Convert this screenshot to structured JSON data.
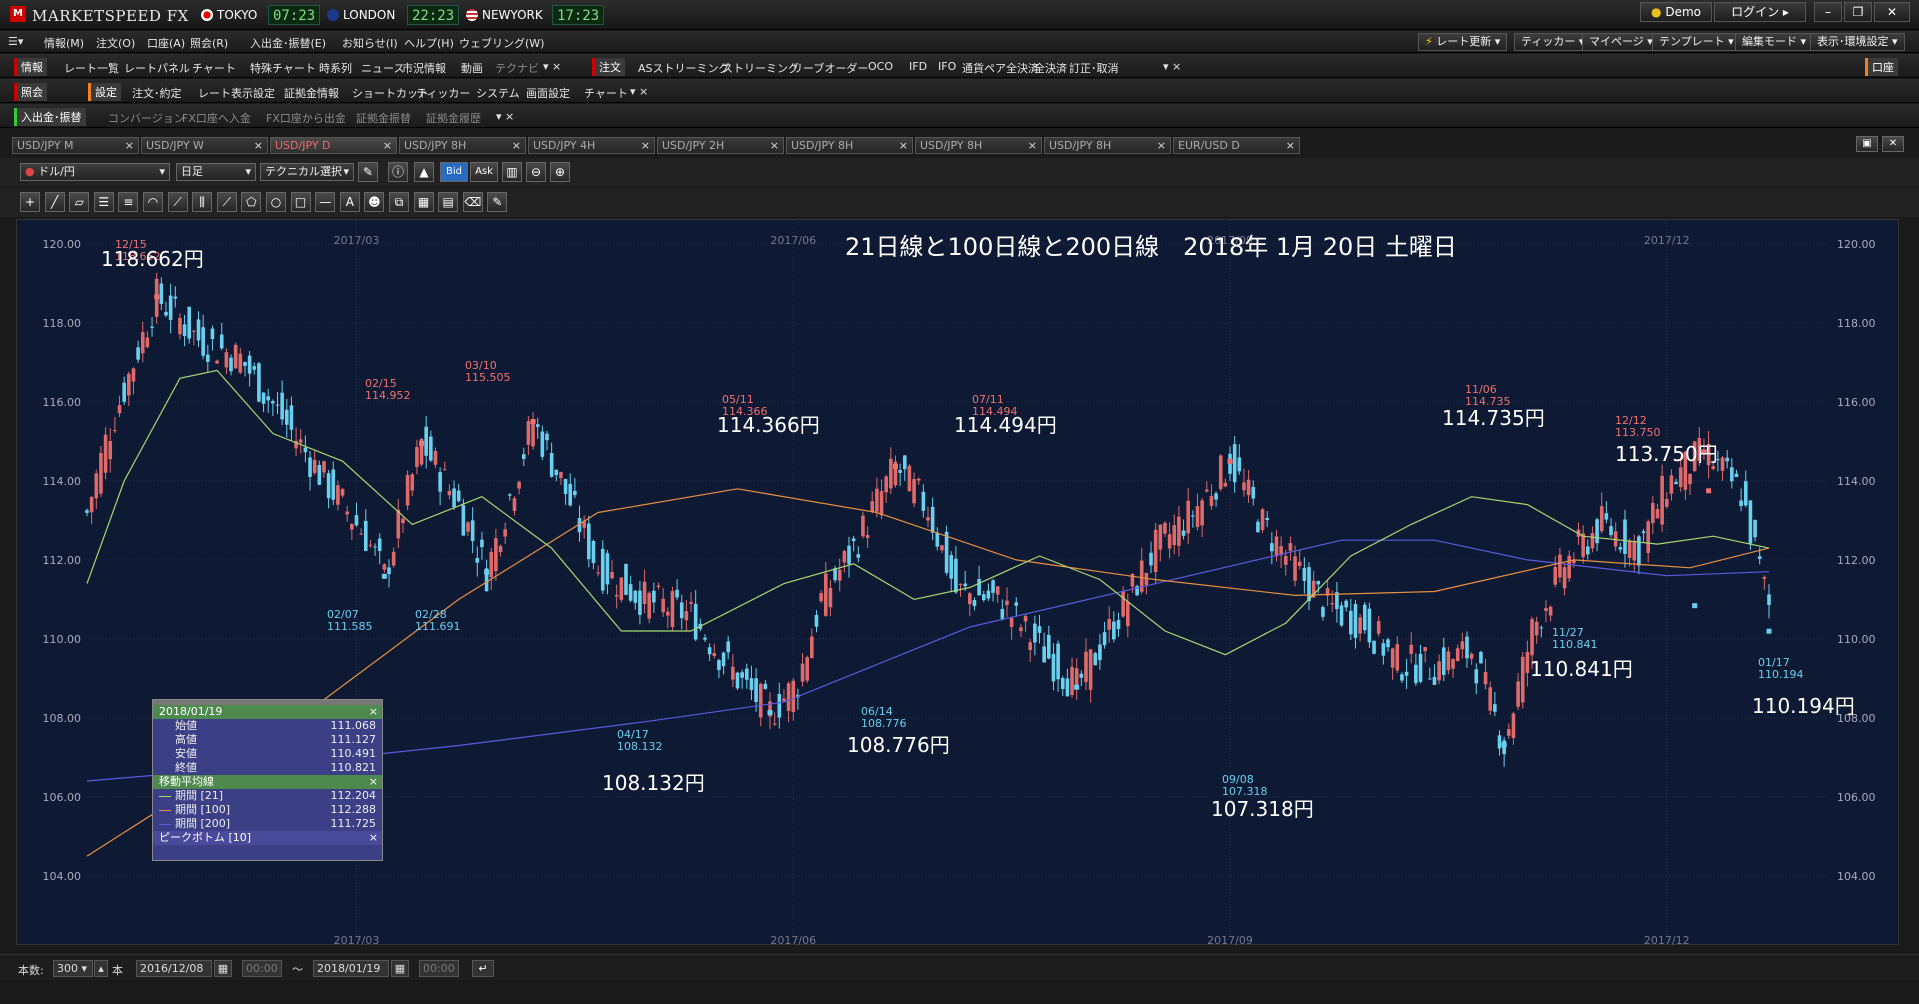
{
  "window": {
    "app_title": "MARKETSPEED FX",
    "clocks": [
      {
        "city": "TOKYO",
        "time": "07:23"
      },
      {
        "city": "LONDON",
        "time": "22:23"
      },
      {
        "city": "NEWYORK",
        "time": "17:23"
      }
    ],
    "demo_label": "Demo",
    "login_label": "ログイン"
  },
  "menubar": [
    "情報(M)",
    "注文(O)",
    "口座(A)",
    "照会(R)",
    "入出金･振替(E)",
    "お知らせ(I)",
    "ヘルプ(H)",
    "ウェブリング(W)"
  ],
  "toolbar1": {
    "info_group": "情報",
    "info_items": [
      "レート一覧",
      "レートパネル",
      "チャート",
      "特殊チャート",
      "時系列",
      "ニュース",
      "市況情報",
      "動画",
      "テクナビ"
    ],
    "order_group": "注文",
    "order_items": [
      "ASストリーミング",
      "ストリーミング",
      "リーブオーダー",
      "OCO",
      "IFD",
      "IFO",
      "通貨ペア全決済",
      "全決済",
      "訂正･取消"
    ],
    "right_buttons": [
      "レート更新",
      "ティッカー",
      "マイページ",
      "テンプレート",
      "編集モード",
      "表示･環境設定"
    ],
    "account_button": "口座"
  },
  "toolbar2": {
    "inquiry_group": "照会",
    "settings_group": "設定",
    "settings_items": [
      "注文･約定",
      "レート表示設定",
      "証拠金情報",
      "ショートカット",
      "ティッカー",
      "システム",
      "画面設定",
      "チャート"
    ]
  },
  "toolbar3": {
    "deposit_group": "入出金･振替",
    "deposit_items": [
      "コンバージョン",
      "FX口座へ入金",
      "FX口座から出金",
      "証拠金振替",
      "証拠金履歴"
    ]
  },
  "tabs": [
    "USD/JPY M",
    "USD/JPY W",
    "USD/JPY D",
    "USD/JPY 8H",
    "USD/JPY 4H",
    "USD/JPY 2H",
    "USD/JPY 8H",
    "USD/JPY 8H",
    "USD/JPY 8H",
    "EUR/USD D"
  ],
  "chart_toolbar": {
    "pair": "ドル/円",
    "period": "日足",
    "technical": "テクニカル選択",
    "bid": "Bid",
    "ask": "Ask"
  },
  "chart_data": {
    "type": "candlestick",
    "title": "21日線と100日線と200日線　2018年 1月 20日 土曜日",
    "ylim": [
      103.5,
      120.7
    ],
    "yticks": [
      "120.00",
      "118.00",
      "116.00",
      "114.00",
      "112.00",
      "110.00",
      "108.00",
      "106.00",
      "104.00"
    ],
    "xticks": [
      "2017/03",
      "2017/06",
      "2017/09",
      "2017/12"
    ],
    "colors": {
      "up": "#e06a6a",
      "down": "#6ad0f0",
      "ma21": "#a8d870",
      "ma100": "#e89040",
      "ma200": "#5a5ae0"
    },
    "annotations": [
      {
        "date": "12/15",
        "price": "118.662",
        "kind": "high",
        "big": "118.662円"
      },
      {
        "date": "02/15",
        "price": "114.952",
        "kind": "high"
      },
      {
        "date": "03/10",
        "price": "115.505",
        "kind": "high"
      },
      {
        "date": "02/07",
        "price": "111.585",
        "kind": "low"
      },
      {
        "date": "02/28",
        "price": "111.691",
        "kind": "low"
      },
      {
        "date": "05/11",
        "price": "114.366",
        "kind": "high",
        "big": "114.366円"
      },
      {
        "date": "04/17",
        "price": "108.132",
        "kind": "low",
        "big": "108.132円"
      },
      {
        "date": "06/14",
        "price": "108.776",
        "kind": "low",
        "big": "108.776円"
      },
      {
        "date": "07/11",
        "price": "114.494",
        "kind": "high",
        "big": "114.494円"
      },
      {
        "date": "09/08",
        "price": "107.318",
        "kind": "low",
        "big": "107.318円"
      },
      {
        "date": "11/06",
        "price": "114.735",
        "kind": "high",
        "big": "114.735円"
      },
      {
        "date": "11/27",
        "price": "110.841",
        "kind": "low",
        "big": "110.841円"
      },
      {
        "date": "12/12",
        "price": "113.750",
        "kind": "high",
        "big": "113.750円"
      },
      {
        "date": "01/17",
        "price": "110.194",
        "kind": "low",
        "big": "110.194円"
      }
    ],
    "ma21": [
      [
        0,
        111.4
      ],
      [
        8,
        114
      ],
      [
        20,
        116.6
      ],
      [
        28,
        116.8
      ],
      [
        40,
        115.2
      ],
      [
        55,
        114.5
      ],
      [
        70,
        112.9
      ],
      [
        85,
        113.6
      ],
      [
        100,
        112.3
      ],
      [
        115,
        110.2
      ],
      [
        130,
        110.2
      ],
      [
        150,
        111.4
      ],
      [
        165,
        111.9
      ],
      [
        178,
        111.0
      ],
      [
        190,
        111.3
      ],
      [
        205,
        112.1
      ],
      [
        218,
        111.5
      ],
      [
        232,
        110.2
      ],
      [
        245,
        109.6
      ],
      [
        258,
        110.4
      ],
      [
        272,
        112.1
      ],
      [
        285,
        112.9
      ],
      [
        298,
        113.6
      ],
      [
        310,
        113.4
      ],
      [
        322,
        112.6
      ],
      [
        338,
        112.4
      ],
      [
        350,
        112.6
      ],
      [
        362,
        112.3
      ]
    ],
    "ma100": [
      [
        0,
        104.5
      ],
      [
        40,
        107.5
      ],
      [
        80,
        111.0
      ],
      [
        110,
        113.2
      ],
      [
        140,
        113.8
      ],
      [
        170,
        113.2
      ],
      [
        200,
        112.0
      ],
      [
        230,
        111.5
      ],
      [
        260,
        111.1
      ],
      [
        290,
        111.2
      ],
      [
        320,
        112.0
      ],
      [
        345,
        111.8
      ],
      [
        362,
        112.3
      ]
    ],
    "ma200": [
      [
        0,
        106.4
      ],
      [
        40,
        106.8
      ],
      [
        80,
        107.3
      ],
      [
        120,
        107.9
      ],
      [
        150,
        108.4
      ],
      [
        190,
        110.3
      ],
      [
        230,
        111.4
      ],
      [
        270,
        112.5
      ],
      [
        290,
        112.5
      ],
      [
        310,
        112.0
      ],
      [
        340,
        111.6
      ],
      [
        362,
        111.7
      ]
    ],
    "n_candles": 363
  },
  "info_panel": {
    "date": "2018/01/19",
    "rows": [
      {
        "label": "始値",
        "value": "111.068"
      },
      {
        "label": "高値",
        "value": "111.127"
      },
      {
        "label": "安値",
        "value": "110.491"
      },
      {
        "label": "終値",
        "value": "110.821"
      }
    ],
    "ma_header": "移動平均線",
    "ma_rows": [
      {
        "label": "期間 [21]",
        "value": "112.204",
        "color": "#a8d870"
      },
      {
        "label": "期間 [100]",
        "value": "112.288",
        "color": "#e89040"
      },
      {
        "label": "期間 [200]",
        "value": "111.725",
        "color": "#5a5ae0"
      }
    ],
    "peak_header": "ピークボトム [10]"
  },
  "bottom_bar": {
    "count_label": "本数:",
    "count_value": "300",
    "unit": "本",
    "start_date": "2016/12/08",
    "start_time": "00:00",
    "tilde": "～",
    "end_date": "2018/01/19",
    "end_time": "00:00"
  }
}
